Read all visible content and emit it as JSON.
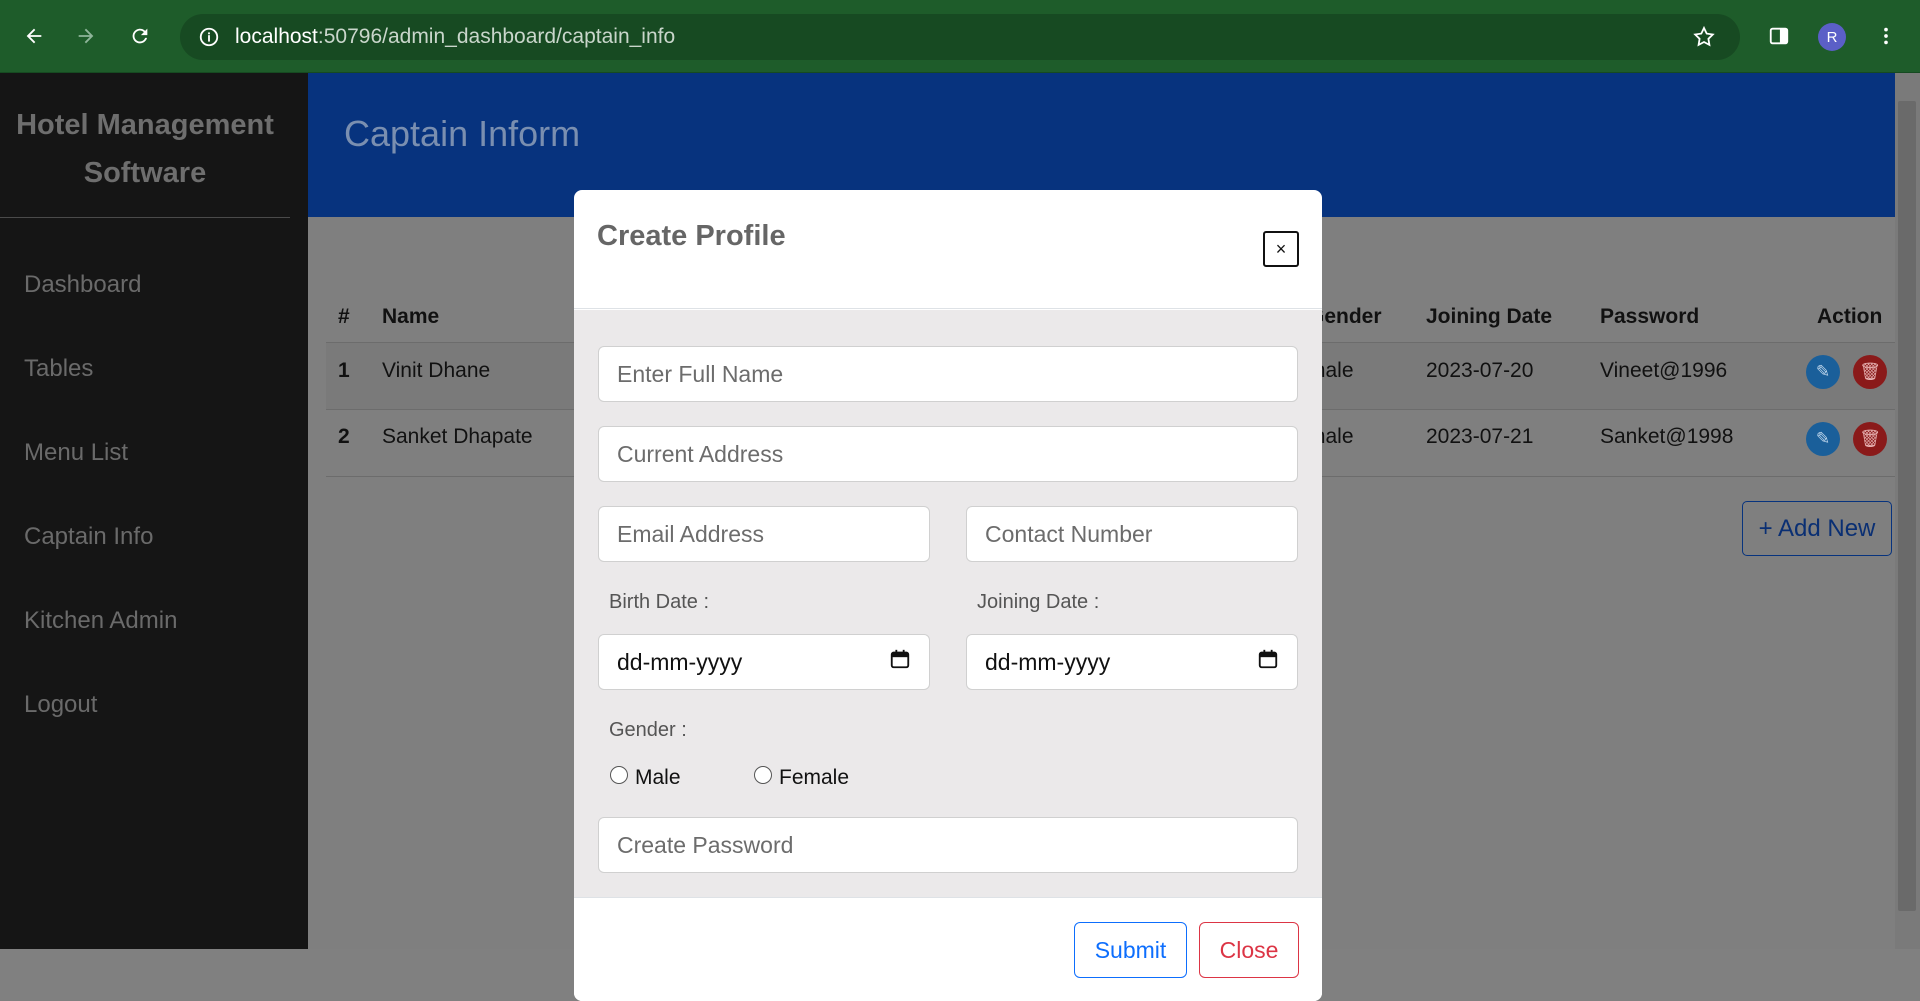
{
  "browser": {
    "url_host": "localhost",
    "url_rest": ":50796/admin_dashboard/captain_info",
    "avatar_initial": "R"
  },
  "sidebar": {
    "brand": "Hotel Management Software",
    "items": [
      {
        "label": "Dashboard"
      },
      {
        "label": "Tables"
      },
      {
        "label": "Menu List"
      },
      {
        "label": "Captain Info"
      },
      {
        "label": "Kitchen Admin"
      },
      {
        "label": "Logout"
      }
    ]
  },
  "banner": {
    "title": "Captain Inform"
  },
  "table": {
    "headers": {
      "num": "#",
      "name": "Name",
      "gender": "Gender",
      "joining": "Joining Date",
      "password": "Password",
      "action": "Action"
    },
    "rows": [
      {
        "num": "1",
        "name": "Vinit Dhane",
        "gender": "male",
        "joining": "2023-07-20",
        "password": "Vineet@1996"
      },
      {
        "num": "2",
        "name": "Sanket Dhapate",
        "gender": "male",
        "joining": "2023-07-21",
        "password": "Sanket@1998"
      }
    ]
  },
  "add_new_label": "+ Add New",
  "modal": {
    "title": "Create Profile",
    "close_x": "×",
    "full_name_placeholder": "Enter Full Name",
    "address_placeholder": "Current Address",
    "email_placeholder": "Email Address",
    "contact_placeholder": "Contact Number",
    "birth_label": "Birth Date :",
    "joining_label": "Joining Date :",
    "date_placeholder": "dd-mm-yyyy",
    "gender_label": "Gender :",
    "gender_male": "Male",
    "gender_female": "Female",
    "password_placeholder": "Create Password",
    "submit_label": "Submit",
    "close_label": "Close"
  }
}
